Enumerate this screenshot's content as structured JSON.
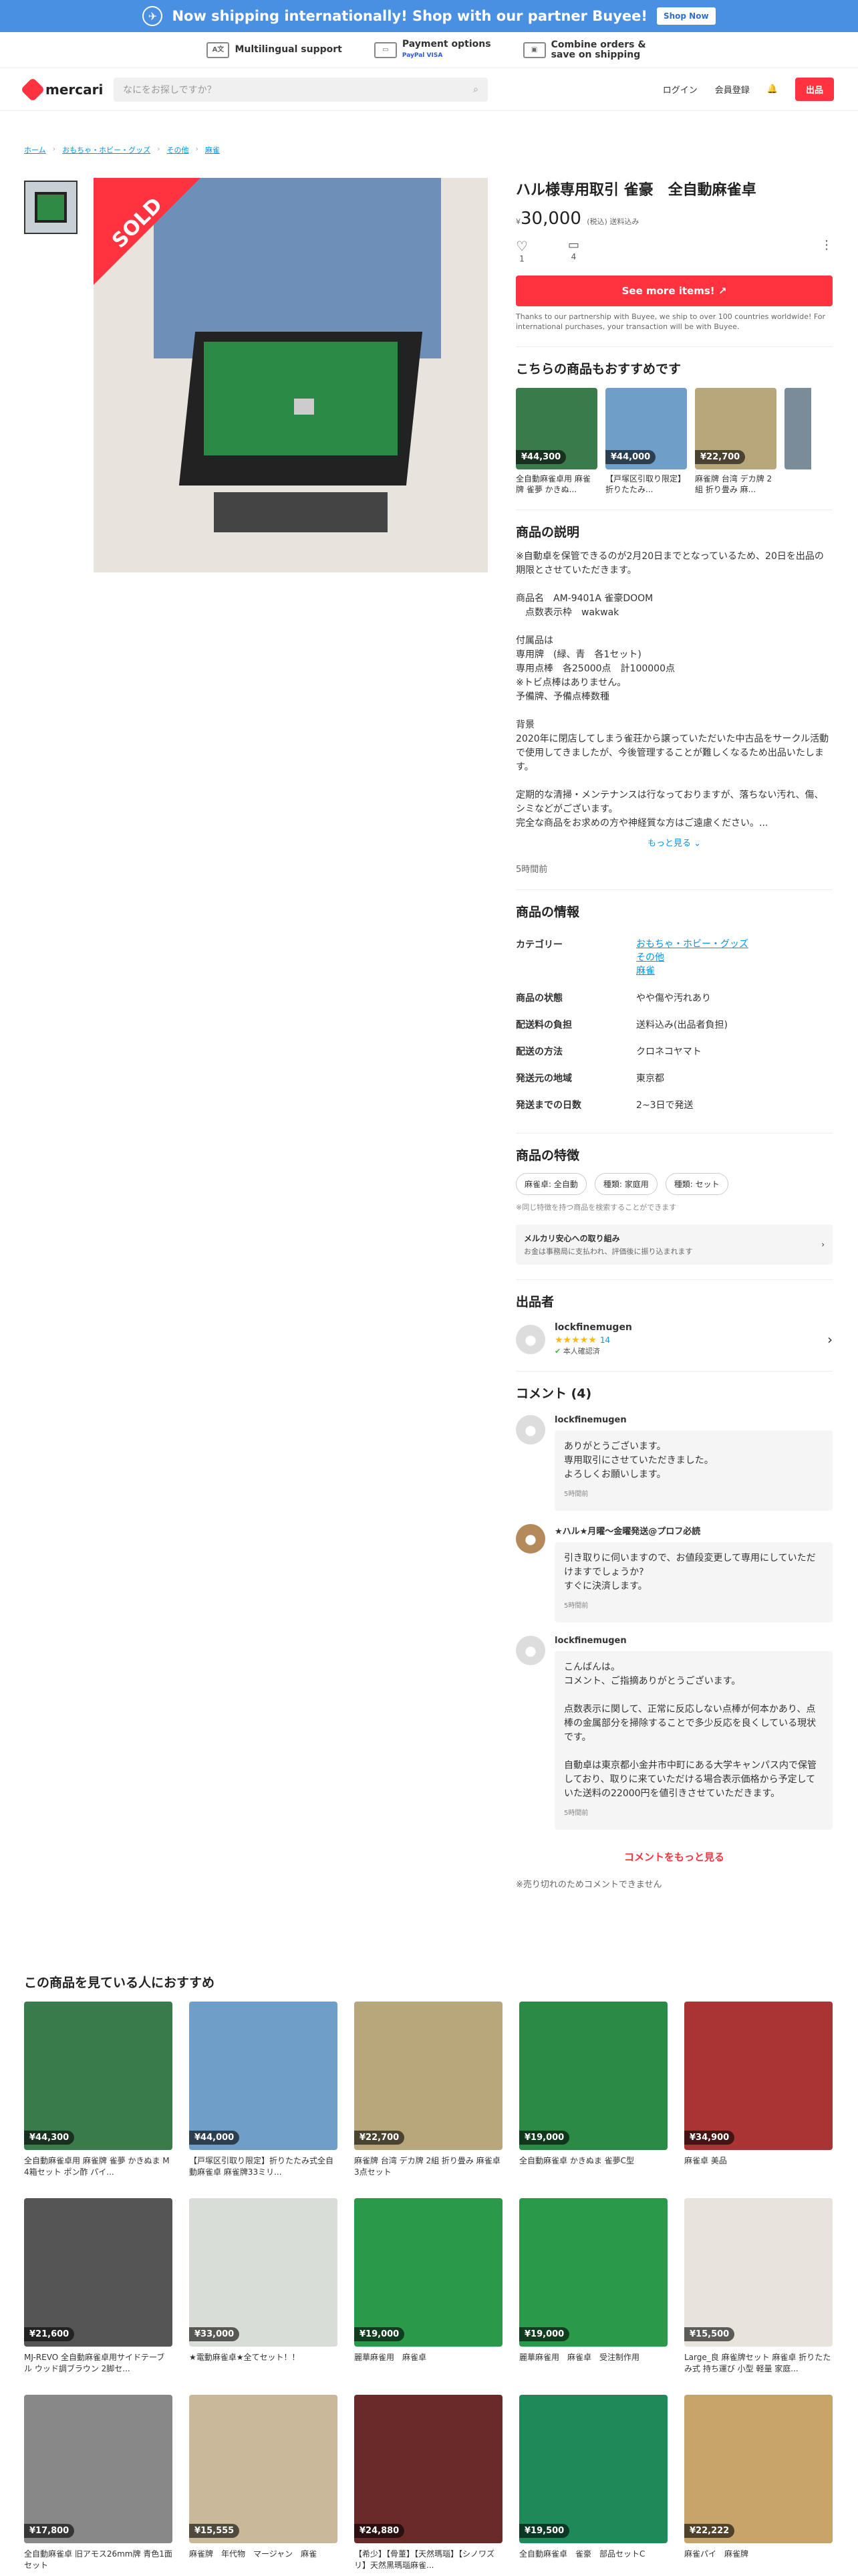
{
  "banner": {
    "text": "Now shipping internationally! Shop with our partner Buyee!",
    "button": "Shop Now"
  },
  "features": [
    {
      "icon": "language-icon",
      "label": "Multilingual support"
    },
    {
      "icon": "card-icon",
      "label": "Payment options",
      "sub": "PayPal VISA"
    },
    {
      "icon": "box-icon",
      "label": "Combine orders & save on shipping"
    }
  ],
  "header": {
    "logo": "mercari",
    "search_placeholder": "なにをお探しですか？",
    "login": "ログイン",
    "signup": "会員登録",
    "sell": "出品"
  },
  "breadcrumb": [
    "ホーム",
    "おもちゃ・ホビー・グッズ",
    "その他",
    "麻雀"
  ],
  "product": {
    "sold": "SOLD",
    "title": "ハル様専用取引 雀豪　全自動麻雀卓",
    "price_symbol": "¥",
    "price": "30,000",
    "price_note": "(税込) 送料込み",
    "likes": "1",
    "comments": "4",
    "cta": "See more items!",
    "cta_note": "Thanks to our partnership with Buyee, we ship to over 100 countries worldwide! For international purchases, your transaction will be with Buyee.",
    "rec_title": "こちらの商品もおすすめです",
    "recs": [
      {
        "price": "¥44,300",
        "name": "全自動麻雀卓用 麻雀牌 雀夢 かきぬ..."
      },
      {
        "price": "¥44,000",
        "name": "【戸塚区引取り限定】折りたたみ..."
      },
      {
        "price": "¥22,700",
        "name": "麻雀牌 台湾 デカ牌 2組 折り畳み 麻..."
      }
    ],
    "desc_title": "商品の説明",
    "desc": "※自動卓を保管できるのが2月20日までとなっているため、20日を出品の期限とさせていただきます。\n\n商品名　AM-9401A 雀豪DOOM\n　点数表示枠　wakwak\n\n付属品は\n専用牌　(緑、青　各1セット)\n専用点棒　各25000点　計100000点\n※トビ点棒はありません。\n予備牌、予備点棒数種\n\n背景\n2020年に閉店してしまう雀荘から譲っていただいた中古品をサークル活動で使用してきましたが、今後管理することが難しくなるため出品いたします。\n\n定期的な清掃・メンテナンスは行なっておりますが、落ちない汚れ、傷、シミなどがございます。\n完全な商品をお求めの方や神経質な方はご遠慮ください。...",
    "more": "もっと見る",
    "posted": "5時間前",
    "info_title": "商品の情報",
    "info": {
      "category_label": "カテゴリー",
      "categories": [
        "おもちゃ・ホビー・グッズ",
        "その他",
        "麻雀"
      ],
      "condition_label": "商品の状態",
      "condition": "やや傷や汚れあり",
      "shipfee_label": "配送料の負担",
      "shipfee": "送料込み(出品者負担)",
      "method_label": "配送の方法",
      "method": "クロネコヤマト",
      "origin_label": "発送元の地域",
      "origin": "東京都",
      "days_label": "発送までの日数",
      "days": "2~3日で発送"
    },
    "feature_title": "商品の特徴",
    "chips": [
      "麻雀卓: 全自動",
      "種類: 家庭用",
      "種類: セット"
    ],
    "chips_note": "※同じ特徴を持つ商品を検索することができます",
    "safe_title": "メルカリ安心への取り組み",
    "safe_sub": "お金は事務局に支払われ、評価後に振り込まれます",
    "seller_title": "出品者",
    "seller_name": "lockfinemugen",
    "seller_rating": "14",
    "seller_verified": "本人確認済",
    "comments_title": "コメント (4)",
    "comment_list": [
      {
        "name": "lockfinemugen",
        "text": "ありがとうございます。\n専用取引にさせていただきました。\nよろしくお願いします。",
        "time": "5時間前"
      },
      {
        "name": "★ハル★月曜〜金曜発送@プロフ必読",
        "text": "引き取りに伺いますので、お値段変更して専用にしていただけますでしょうか?\nすぐに決済します。",
        "time": "5時間前"
      },
      {
        "name": "lockfinemugen",
        "text": "こんばんは。\nコメント、ご指摘ありがとうございます。\n\n点数表示に関して、正常に反応しない点棒が何本かあり、点棒の金属部分を掃除することで多少反応を良くしている現状です。\n\n自動卓は東京都小金井市中町にある大学キャンパス内で保管しており、取りに来ていただける場合表示価格から予定していた送料の22000円を値引きさせていただきます。",
        "time": "5時間前"
      }
    ],
    "comments_more": "コメントをもっと見る",
    "comments_closed": "※売り切れのためコメントできません"
  },
  "grid_title": "この商品を見ている人におすすめ",
  "grid": [
    {
      "price": "¥44,300",
      "name": "全自動麻雀卓用 麻雀牌 雀夢 かきぬま M 4箱セット ポン酢 パイ..."
    },
    {
      "price": "¥44,000",
      "name": "【戸塚区引取り限定】折りたたみ式全自動麻雀卓 麻雀牌33ミリ..."
    },
    {
      "price": "¥22,700",
      "name": "麻雀牌 台湾 デカ牌 2組 折り畳み 麻雀卓 3点セット"
    },
    {
      "price": "¥19,000",
      "name": "全自動麻雀卓 かきぬま 雀夢C型"
    },
    {
      "price": "¥34,900",
      "name": "麻雀卓 美品"
    },
    {
      "price": "¥21,600",
      "name": "MJ-REVO 全自動麻雀卓用サイドテーブル ウッド調ブラウン 2脚セ..."
    },
    {
      "price": "¥33,000",
      "name": "★電動麻雀卓★全てセット！！"
    },
    {
      "price": "¥19,000",
      "name": "麗華麻雀用　麻雀卓"
    },
    {
      "price": "¥19,000",
      "name": "麗華麻雀用　麻雀卓　受注制作用"
    },
    {
      "price": "¥15,500",
      "name": "Large_良 麻雀牌セット 麻雀卓 折りたたみ式 持ち運び 小型 軽量 家庭..."
    },
    {
      "price": "¥17,800",
      "name": "全自動麻雀卓 旧アモス26mm牌 青色1面セット"
    },
    {
      "price": "¥15,555",
      "name": "麻雀牌　年代物　マージャン　麻雀"
    },
    {
      "price": "¥24,880",
      "name": "【希少】【骨董】【天然瑪瑙】【シノワズリ】天然黒瑪瑙麻雀..."
    },
    {
      "price": "¥19,500",
      "name": "全自動麻雀卓　雀豪　部品セットC"
    },
    {
      "price": "¥22,222",
      "name": "麻雀パイ　麻雀牌"
    }
  ]
}
